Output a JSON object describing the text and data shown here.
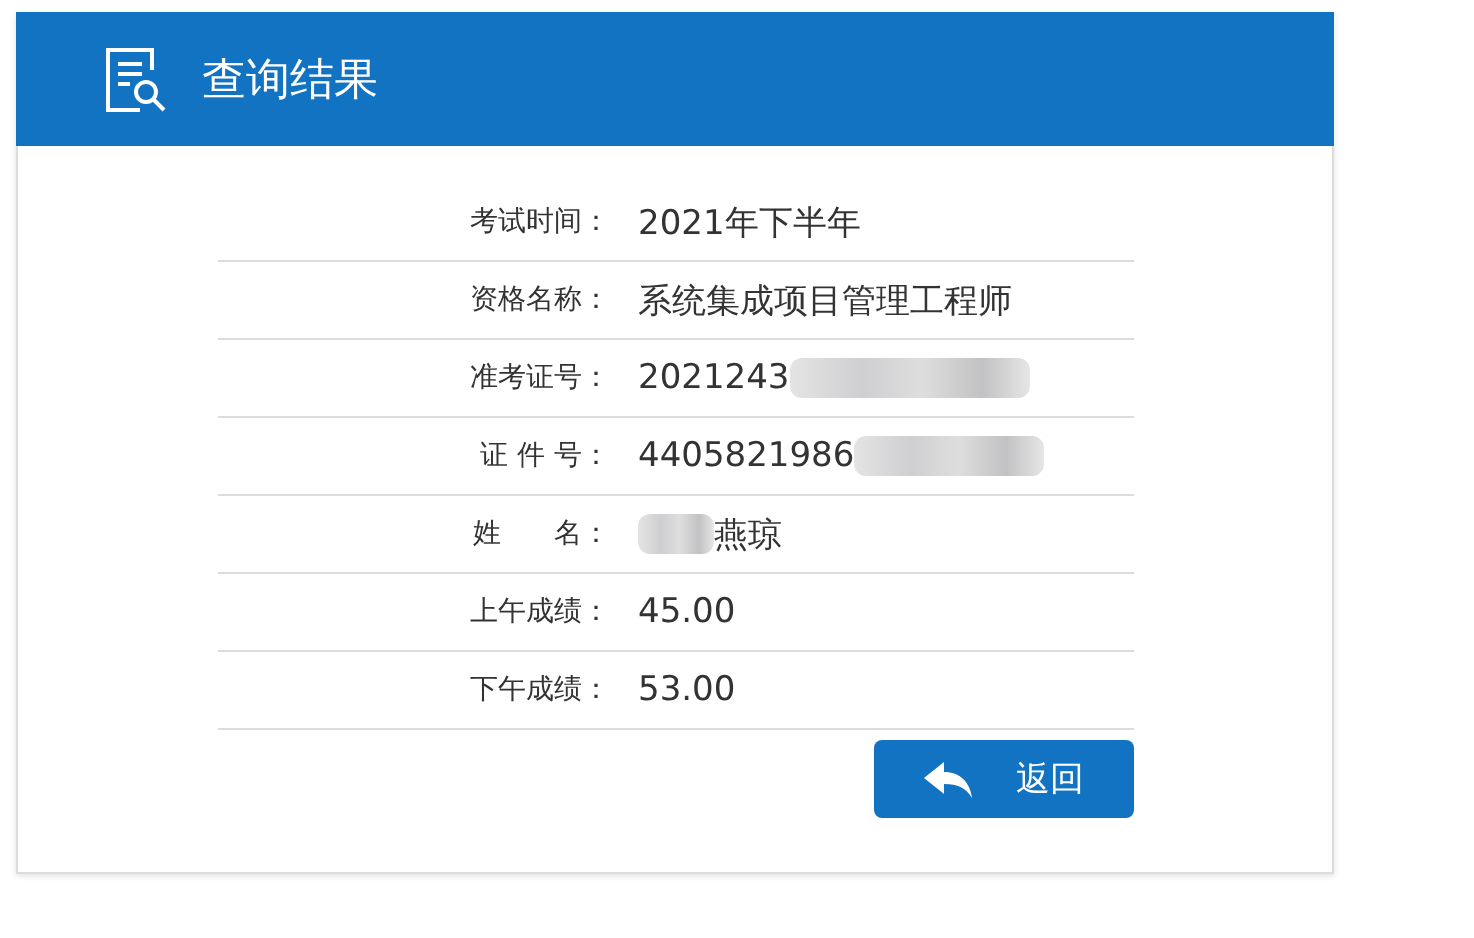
{
  "header": {
    "title": "查询结果"
  },
  "rows": [
    {
      "kind": "plain",
      "label": "考试时间：",
      "value": "2021年下半年"
    },
    {
      "kind": "plain",
      "label": "资格名称：",
      "value": "系统集成项目管理工程师"
    },
    {
      "kind": "redacted_end",
      "label": "准考证号：",
      "value": "2021243"
    },
    {
      "kind": "redacted_end",
      "label": "证 件 号：",
      "value": "4405821986"
    },
    {
      "kind": "redacted_start",
      "label": "姓      名：",
      "value": "燕琼"
    },
    {
      "kind": "plain",
      "label": "上午成绩：",
      "value": "45.00"
    },
    {
      "kind": "plain",
      "label": "下午成绩：",
      "value": "53.00"
    }
  ],
  "back_button": {
    "label": "返回"
  }
}
